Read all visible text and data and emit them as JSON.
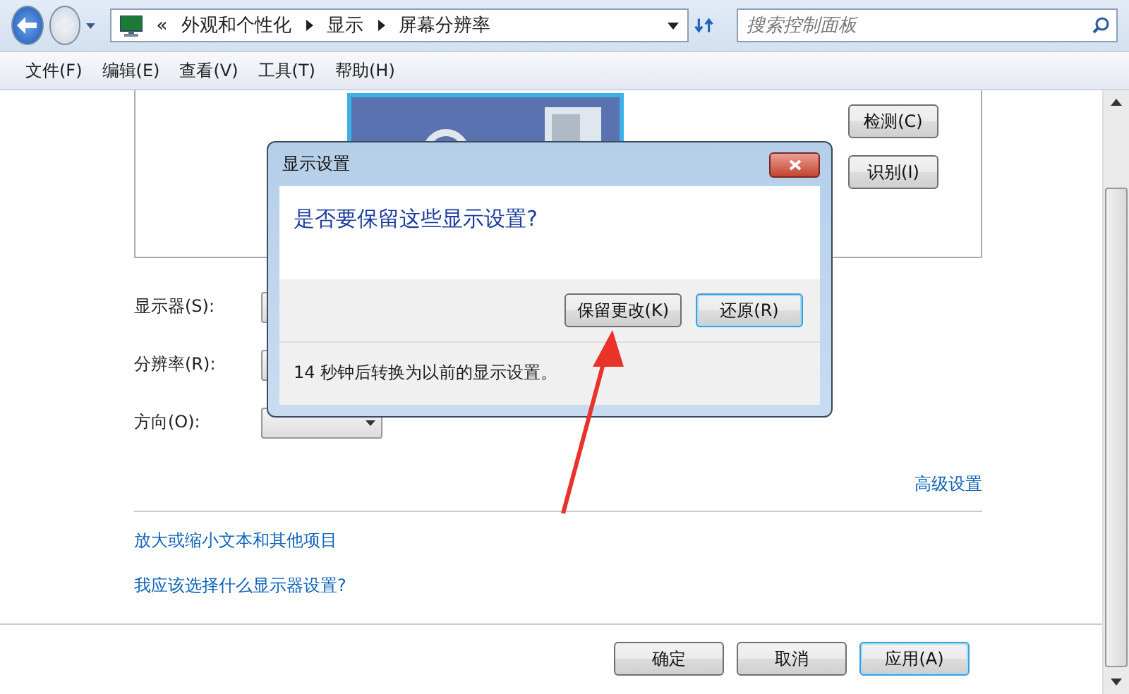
{
  "nav": {
    "prefix": "«",
    "breadcrumbs": [
      "外观和个性化",
      "显示",
      "屏幕分辨率"
    ],
    "search": {
      "placeholder": "搜索控制面板"
    }
  },
  "menu": [
    "文件(F)",
    "编辑(E)",
    "查看(V)",
    "工具(T)",
    "帮助(H)"
  ],
  "preview_buttons": [
    "检测(C)",
    "识别(I)"
  ],
  "settings": [
    {
      "label": "显示器(S):"
    },
    {
      "label": "分辨率(R):"
    },
    {
      "label": "方向(O):"
    }
  ],
  "advanced_link": "高级设置",
  "links": [
    "放大或缩小文本和其他项目",
    "我应该选择什么显示器设置?"
  ],
  "buttons": [
    {
      "label": "确定",
      "focused": false
    },
    {
      "label": "取消",
      "focused": false
    },
    {
      "label": "应用(A)",
      "focused": true
    }
  ],
  "dialog": {
    "title": "显示设置",
    "question": "是否要保留这些显示设置?",
    "buttons": [
      {
        "label": "保留更改(K)",
        "focused": false
      },
      {
        "label": "还原(R)",
        "focused": true
      }
    ],
    "countdown": "14 秒钟后转换为以前的显示设置。"
  }
}
